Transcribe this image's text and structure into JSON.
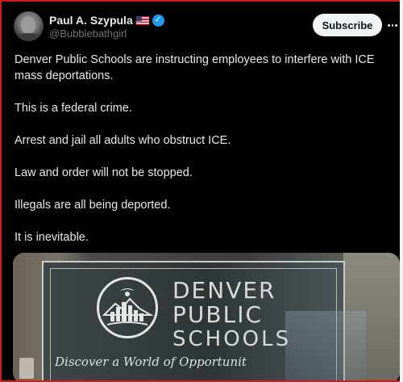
{
  "post": {
    "author": {
      "display_name": "Paul A. Szypula",
      "handle": "@Bubblebathgirl",
      "flag_icon": "us-flag-icon",
      "verified_icon": "verified-badge-icon",
      "verified_glyph": "✓"
    },
    "subscribe_label": "Subscribe",
    "more_icon": "more-options-icon",
    "paragraphs": [
      "Denver Public Schools are instructing employees to interfere with ICE mass deportations.",
      "This is a federal crime.",
      "Arrest and jail all adults who obstruct ICE.",
      "Law and order will not be stopped.",
      "Illegals are all being deported.",
      "It is inevitable."
    ],
    "media": {
      "sign_lines": [
        "DENVER",
        "PUBLIC",
        "SCHOOLS"
      ],
      "tagline": "Discover a World of Opportunit"
    }
  },
  "colors": {
    "background": "#000000",
    "text": "#e7e9ea",
    "muted": "#71767b",
    "verified": "#1d9bf0",
    "subscribe_bg": "#eff3f4",
    "frame_border": "#d01c1c"
  }
}
